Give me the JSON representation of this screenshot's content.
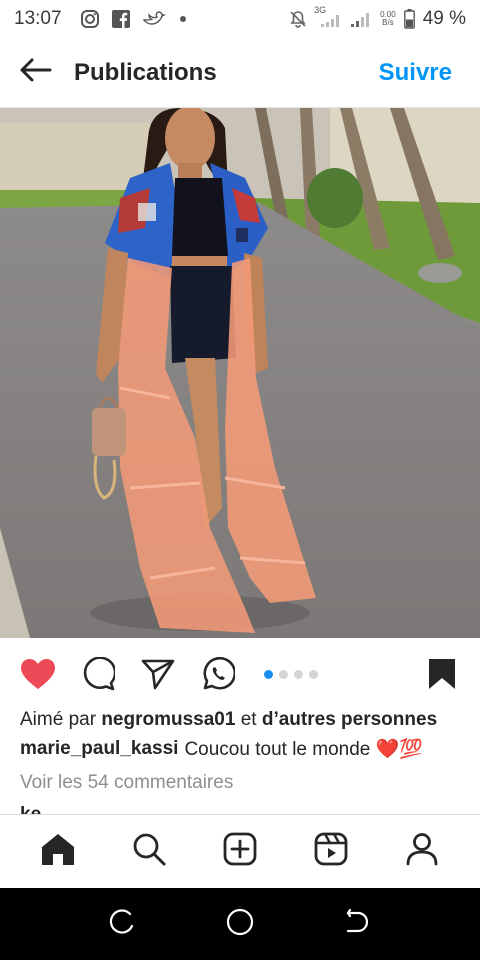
{
  "status_bar": {
    "time": "13:07",
    "network": "3G",
    "speed_value": "0.00",
    "speed_unit": "B/s",
    "battery": "49 %"
  },
  "header": {
    "title": "Publications",
    "follow_label": "Suivre"
  },
  "post": {
    "image_icon": "photo-woman-orange-tulle-dress",
    "carousel": {
      "count": 4,
      "active_index": 0
    }
  },
  "likes": {
    "prefix": "Aimé par",
    "user": "negromussa01",
    "connector": "et",
    "rest": "d’autres personnes"
  },
  "caption": {
    "username": "marie_paul_kassi",
    "text": "Coucou tout le monde ❤️💯"
  },
  "comments": {
    "view_all": "Voir les 54 commentaires",
    "peek": "ke___"
  },
  "colors": {
    "accent": "#0095f6",
    "like": "#ed4956",
    "dot_active": "#1b8ff0"
  },
  "icons": {
    "back": "arrow-left-icon",
    "like": "heart-filled-icon",
    "comment": "speech-bubble-icon",
    "share": "paper-plane-icon",
    "whatsapp": "whatsapp-icon",
    "save": "bookmark-filled-icon",
    "nav": [
      "home-icon",
      "search-icon",
      "add-post-icon",
      "reels-icon",
      "profile-icon"
    ]
  }
}
